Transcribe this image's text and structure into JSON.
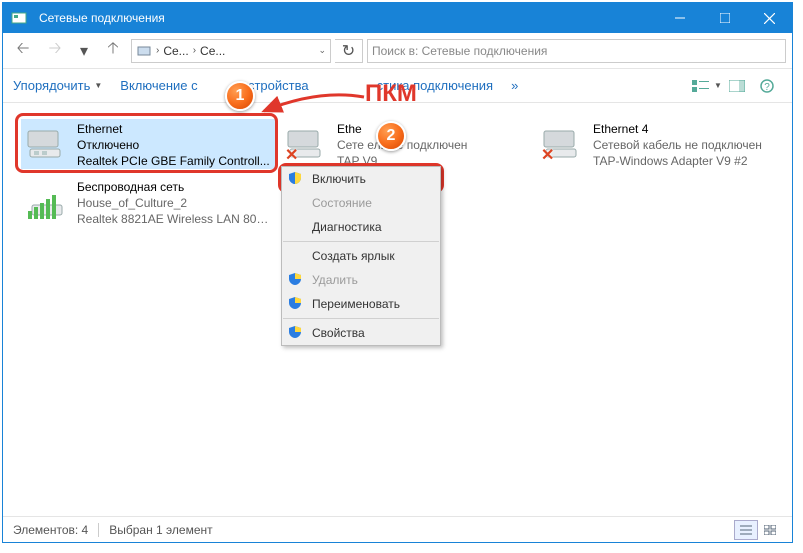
{
  "titlebar": {
    "title": "Сетевые подключения"
  },
  "breadcrumb": {
    "part1": "Се...",
    "part2": "Се..."
  },
  "search": {
    "placeholder": "Поиск в: Сетевые подключения"
  },
  "toolbar": {
    "organize": "Упорядочить",
    "enable": "Включение с",
    "device": "устройства",
    "diagnose": "стика подключения",
    "overflow": "»"
  },
  "annotations": {
    "pkm": "ПКМ",
    "bubble1": "1",
    "bubble2": "2"
  },
  "adapters": [
    {
      "name": "Ethernet",
      "status": "Отключено",
      "device": "Realtek PCIe GBE Family Controll..."
    },
    {
      "name": "Ethe",
      "status": "Сете             ель не подключен",
      "device": "TAP                  V9"
    },
    {
      "name": "Ethernet 4",
      "status": "Сетевой кабель не подключен",
      "device": "TAP-Windows Adapter V9 #2"
    },
    {
      "name": "Беспроводная сеть",
      "status": "House_of_Culture_2",
      "device": "Realtek 8821AE Wireless LAN 802...."
    }
  ],
  "contextmenu": {
    "enable": "Включить",
    "status": "Состояние",
    "diagnose": "Диагностика",
    "shortcut": "Создать ярлык",
    "delete": "Удалить",
    "rename": "Переименовать",
    "properties": "Свойства"
  },
  "statusbar": {
    "count": "Элементов: 4",
    "selected": "Выбран 1 элемент"
  }
}
